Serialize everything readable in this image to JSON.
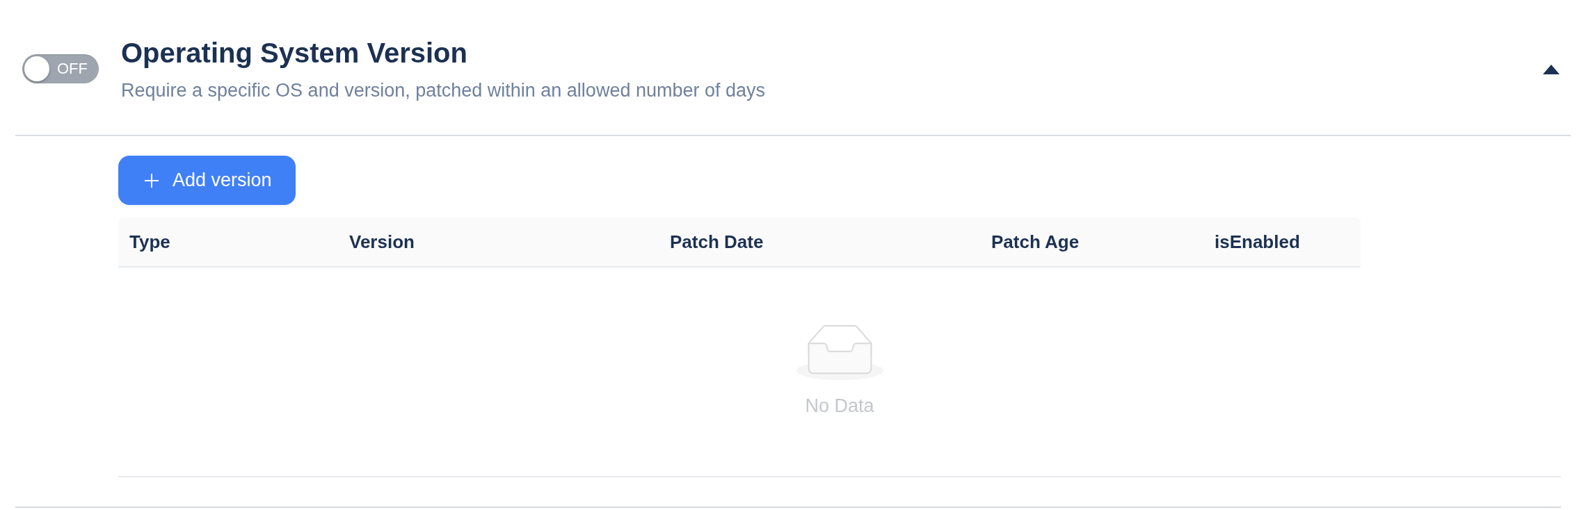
{
  "section": {
    "title": "Operating System Version",
    "description": "Require a specific OS and version, patched within an allowed number of days",
    "toggle": {
      "on": false,
      "label": "OFF"
    },
    "expanded": true
  },
  "add_button": {
    "label": "Add version"
  },
  "table": {
    "columns": [
      "Type",
      "Version",
      "Patch Date",
      "Patch Age",
      "isEnabled"
    ],
    "empty_text": "No Data"
  }
}
